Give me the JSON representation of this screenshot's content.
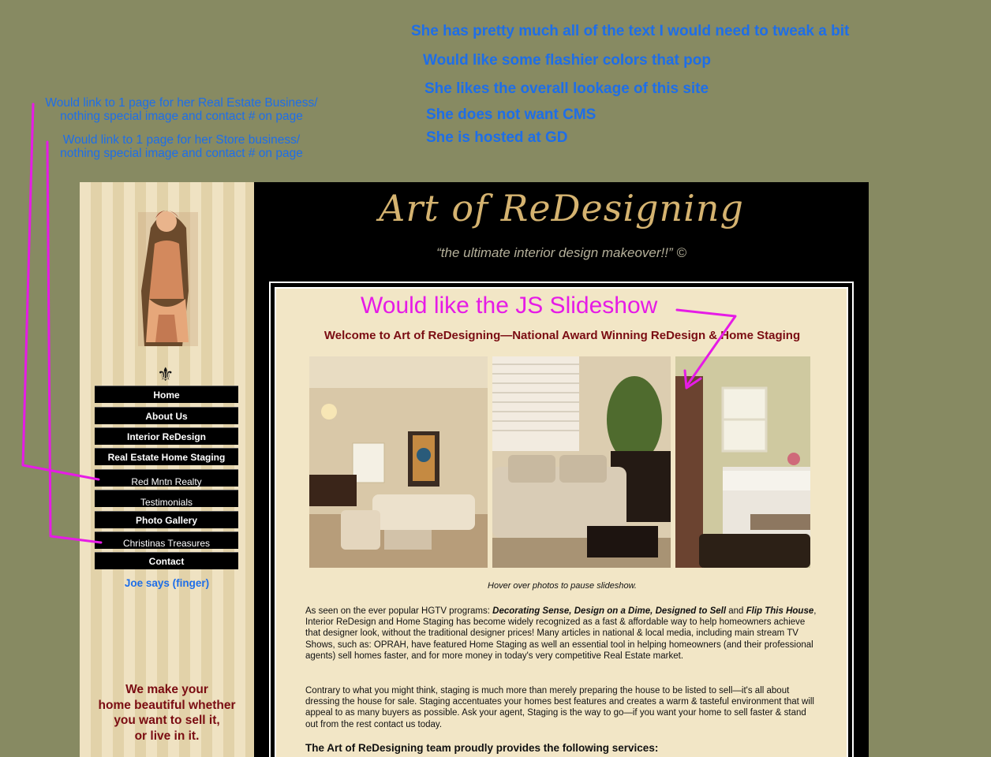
{
  "notes": {
    "top": [
      "She has pretty much all of the text  I would need to tweak a bit",
      "Would like some flashier colors that pop",
      "She likes the  overall lookage of this site",
      "She does not want CMS",
      "She is hosted at GD"
    ],
    "left": [
      "Would link to 1 page for her Real Estate Business/",
      "nothing special image and contact # on page",
      "Would link to 1 page for her Store business/",
      "nothing special image and contact # on page"
    ],
    "slideshow": "Would like the JS Slideshow"
  },
  "site": {
    "title": "Art of ReDesigning",
    "subtitle": "“the ultimate interior design makeover!!” ©",
    "nav": [
      "Home",
      "About Us",
      "Interior ReDesign",
      "Real Estate Home Staging",
      "Red Mntn Realty",
      "Testimonials",
      "Photo Gallery",
      "Christinas Treasures",
      "Contact"
    ],
    "joe_says": "Joe says (finger)",
    "tagline": [
      "We make your",
      "home beautiful whether",
      "you want to sell it,",
      "or live in it."
    ],
    "welcome": "Welcome to Art of ReDesigning—National Award Winning ReDesign & Home Staging",
    "caption": "Hover over photos to pause slideshow.",
    "para1": {
      "a": "As seen on the ever popular HGTV programs: ",
      "b": "Decorating Sense, Design on a Dime, Designed to Sell",
      "c": " and ",
      "d": "Flip This House",
      "e": ", Interior ReDesign and Home Staging has become widely recognized as a fast &  affordable way to help homeowners achieve that designer look, without the traditional designer prices! Many articles in national & local media, including main stream TV Shows, such as: OPRAH, have featured Home Staging as well an essential tool in helping homeowners (and their professional agents) sell homes faster, and for more money in today's very competitive Real Estate market."
    },
    "para2": "Contrary to what you might think, staging is much more than merely preparing the house to be listed to sell—it's all about dressing the house for sale. Staging accentuates your homes best features and creates a warm & tasteful environment that will appeal to as many buyers as possible. Ask your agent, Staging is the way to go—if you want your home to sell faster & stand out from the rest contact us today.",
    "services": "The Art of ReDesigning team proudly provides the following services:"
  },
  "colors": {
    "background": "#878a62",
    "note_blue": "#1e6ee8",
    "annotation_magenta": "#e61be6",
    "title_gold": "#d5b370",
    "maroon": "#7a0c12"
  }
}
